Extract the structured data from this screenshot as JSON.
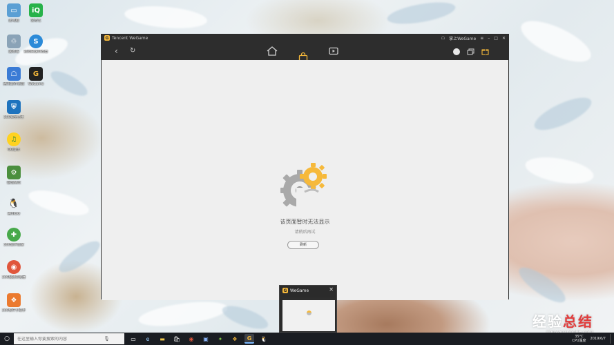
{
  "desktop": {
    "icons": [
      {
        "label": "此电脑",
        "color": "#5a9fd4",
        "glyph": "▭"
      },
      {
        "label": "爱奇艺",
        "color": "#27b24a",
        "glyph": "iQ"
      },
      {
        "label": "回收站",
        "color": "#8aa3b7",
        "glyph": "♲"
      },
      {
        "label": "搜狗高速浏览器",
        "color": "#2b8ad8",
        "glyph": "S"
      },
      {
        "label": "腾讯软件管理",
        "color": "#3a7bd5",
        "glyph": "☖"
      },
      {
        "label": "WeGame",
        "color": "#f6b93b",
        "glyph": "G"
      },
      {
        "label": "360安全卫士",
        "color": "#1e73be",
        "glyph": "⛨"
      },
      {
        "label": "QQ音乐",
        "color": "#ffd21f",
        "glyph": "♫"
      },
      {
        "label": "驱动精灵",
        "color": "#4b8f3e",
        "glyph": "⚙"
      },
      {
        "label": "腾讯QQ",
        "color": "#222",
        "glyph": "🐧"
      },
      {
        "label": "360软件管家",
        "color": "#47a94a",
        "glyph": "✚"
      },
      {
        "label": "360极速浏览器",
        "color": "#e0563c",
        "glyph": "◉"
      },
      {
        "label": "360软件小助手",
        "color": "#eb7a2f",
        "glyph": "❖"
      }
    ]
  },
  "app": {
    "brand": "Tencent WeGame",
    "title_right": "掌上WeGame",
    "tabs": [
      {
        "name": "home"
      },
      {
        "label": "商店",
        "active": true
      },
      {
        "name": "video"
      }
    ],
    "accent": "#f6b93b",
    "error_title": "该页面暂时无法显示",
    "error_subtitle": "请稍后再试",
    "refresh_label": "刷新"
  },
  "preview": {
    "title": "WeGame",
    "close": "✕"
  },
  "taskbar": {
    "search_placeholder": "在这里输入你要搜索的内容",
    "temp": "35°C",
    "temp_label": "CPU温度",
    "time": "",
    "date": "2019/6/7"
  },
  "watermark": {
    "logo_a": "经验",
    "logo_b": "总结",
    "url": "jingyanzongjie.com"
  }
}
